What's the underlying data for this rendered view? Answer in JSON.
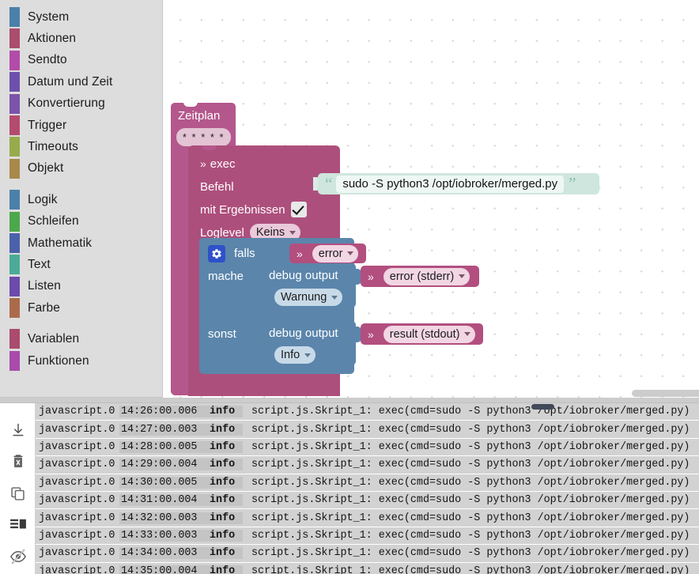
{
  "toolbox": {
    "groups": [
      {
        "items": [
          {
            "label": "System",
            "color": "#4b80a8"
          },
          {
            "label": "Aktionen",
            "color": "#ab4d6e"
          },
          {
            "label": "Sendto",
            "color": "#b34ba8"
          },
          {
            "label": "Datum und Zeit",
            "color": "#6b51ab"
          },
          {
            "label": "Konvertierung",
            "color": "#7b53ab"
          },
          {
            "label": "Trigger",
            "color": "#b44b6e"
          },
          {
            "label": "Timeouts",
            "color": "#96ab4b"
          },
          {
            "label": "Objekt",
            "color": "#a8894b"
          }
        ]
      },
      {
        "items": [
          {
            "label": "Logik",
            "color": "#4b80a8"
          },
          {
            "label": "Schleifen",
            "color": "#4ba84b"
          },
          {
            "label": "Mathematik",
            "color": "#4b62ab"
          },
          {
            "label": "Text",
            "color": "#4bab96"
          },
          {
            "label": "Listen",
            "color": "#6b4bab"
          },
          {
            "label": "Farbe",
            "color": "#ab6b4b"
          }
        ]
      },
      {
        "items": [
          {
            "label": "Variablen",
            "color": "#ab4b6e"
          },
          {
            "label": "Funktionen",
            "color": "#a84bab"
          }
        ]
      }
    ]
  },
  "workspace": {
    "schedule_block": {
      "title": "Zeitplan",
      "cron": "* * * * *"
    },
    "exec_block": {
      "title": "exec",
      "chevron": "»",
      "command_label": "Befehl",
      "with_results_label": "mit Ergebnissen",
      "with_results_checked": true,
      "loglevel_label": "Loglevel",
      "loglevel_value": "Keins"
    },
    "string_block": {
      "quote_open": "“",
      "quote_close": "”",
      "value": "sudo -S python3 /opt/iobroker/merged.py"
    },
    "if_block": {
      "if_label": "falls",
      "do_label": "mache",
      "else_label": "sonst",
      "condition": "error"
    },
    "debug_if": {
      "title": "debug output",
      "level": "Warnung",
      "value": "error (stderr)"
    },
    "debug_else": {
      "title": "debug output",
      "level": "Info",
      "value": "result (stdout)"
    },
    "colors": {
      "schedule": "#b4578c",
      "exec": "#ad4f7c",
      "string": "#cfe6de",
      "logic": "#5b85ab",
      "variable": "#b24f7f"
    }
  },
  "log_panel": {
    "tools": [
      {
        "name": "scroll-to-bottom-icon",
        "title": "scroll to bottom"
      },
      {
        "name": "delete-icon",
        "title": "clear log"
      },
      {
        "name": "copy-icon",
        "title": "copy log"
      },
      {
        "name": "layout-icon",
        "title": "toggle layout"
      },
      {
        "name": "hide-icon",
        "title": "hide log"
      }
    ],
    "rows": [
      {
        "source": "javascript.0",
        "time": "14:26:00.006",
        "severity": "info",
        "message": "script.js.Skript_1: exec(cmd=sudo -S python3 /opt/iobroker/merged.py)"
      },
      {
        "source": "javascript.0",
        "time": "14:27:00.003",
        "severity": "info",
        "message": "script.js.Skript_1: exec(cmd=sudo -S python3 /opt/iobroker/merged.py)"
      },
      {
        "source": "javascript.0",
        "time": "14:28:00.005",
        "severity": "info",
        "message": "script.js.Skript_1: exec(cmd=sudo -S python3 /opt/iobroker/merged.py)"
      },
      {
        "source": "javascript.0",
        "time": "14:29:00.004",
        "severity": "info",
        "message": "script.js.Skript_1: exec(cmd=sudo -S python3 /opt/iobroker/merged.py)"
      },
      {
        "source": "javascript.0",
        "time": "14:30:00.005",
        "severity": "info",
        "message": "script.js.Skript_1: exec(cmd=sudo -S python3 /opt/iobroker/merged.py)"
      },
      {
        "source": "javascript.0",
        "time": "14:31:00.004",
        "severity": "info",
        "message": "script.js.Skript_1: exec(cmd=sudo -S python3 /opt/iobroker/merged.py)"
      },
      {
        "source": "javascript.0",
        "time": "14:32:00.003",
        "severity": "info",
        "message": "script.js.Skript_1: exec(cmd=sudo -S python3 /opt/iobroker/merged.py)"
      },
      {
        "source": "javascript.0",
        "time": "14:33:00.003",
        "severity": "info",
        "message": "script.js.Skript_1: exec(cmd=sudo -S python3 /opt/iobroker/merged.py)"
      },
      {
        "source": "javascript.0",
        "time": "14:34:00.003",
        "severity": "info",
        "message": "script.js.Skript_1: exec(cmd=sudo -S python3 /opt/iobroker/merged.py)"
      },
      {
        "source": "javascript.0",
        "time": "14:35:00.004",
        "severity": "info",
        "message": "script.js.Skript_1: exec(cmd=sudo -S python3 /opt/iobroker/merged.py)"
      }
    ]
  }
}
